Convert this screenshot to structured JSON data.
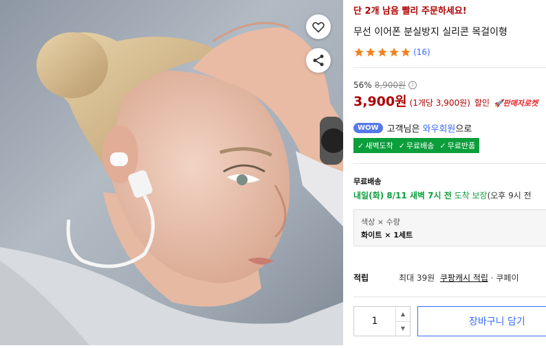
{
  "product": {
    "urgency": "단 2개 남음 빨리 주문하세요!",
    "title": "무선 이어폰 분실방지 실리콘 목걸이형",
    "rating": {
      "stars": 5,
      "review_count": "(16)"
    },
    "discount": {
      "percent": "56%",
      "original_price": "8,900원",
      "info_icon": "ⓘ"
    },
    "price": {
      "sale_price": "3,900원",
      "unit_price": "(1개당 3,900원)",
      "label": "할인",
      "rocket_badge": "🚀판매자로켓"
    },
    "wow": {
      "badge": "WOW",
      "text_prefix": "고객님은",
      "member_link": "와우회원",
      "text_suffix": "으로"
    },
    "benefits": [
      "새벽도착",
      "무료배송",
      "무료반품"
    ],
    "shipping": {
      "title": "무료배송",
      "date_bold": "내일(화) 8/11 새벽 7시 전",
      "arrival": "도착 보장",
      "note": "(오후 9시 전"
    },
    "option": {
      "label": "색상 × 수량",
      "value": "화이트 × 1세트"
    },
    "points": {
      "label": "적립",
      "text_prefix": "최대 39원",
      "cash_link": "쿠팡캐시 적립",
      "text_suffix": "· 쿠페이"
    },
    "purchase": {
      "quantity": "1",
      "cart_button": "장바구니 담기"
    }
  },
  "icons": {
    "heart": "heart-icon",
    "share": "share-icon",
    "arrow_up": "▲",
    "arrow_down": "▼",
    "check": "✓"
  },
  "colors": {
    "accent_red": "#ae0000",
    "star_orange": "#f2821e",
    "link_blue": "#346aff",
    "benefit_green": "#0b9e3b",
    "wow_blue": "#5679e8"
  }
}
